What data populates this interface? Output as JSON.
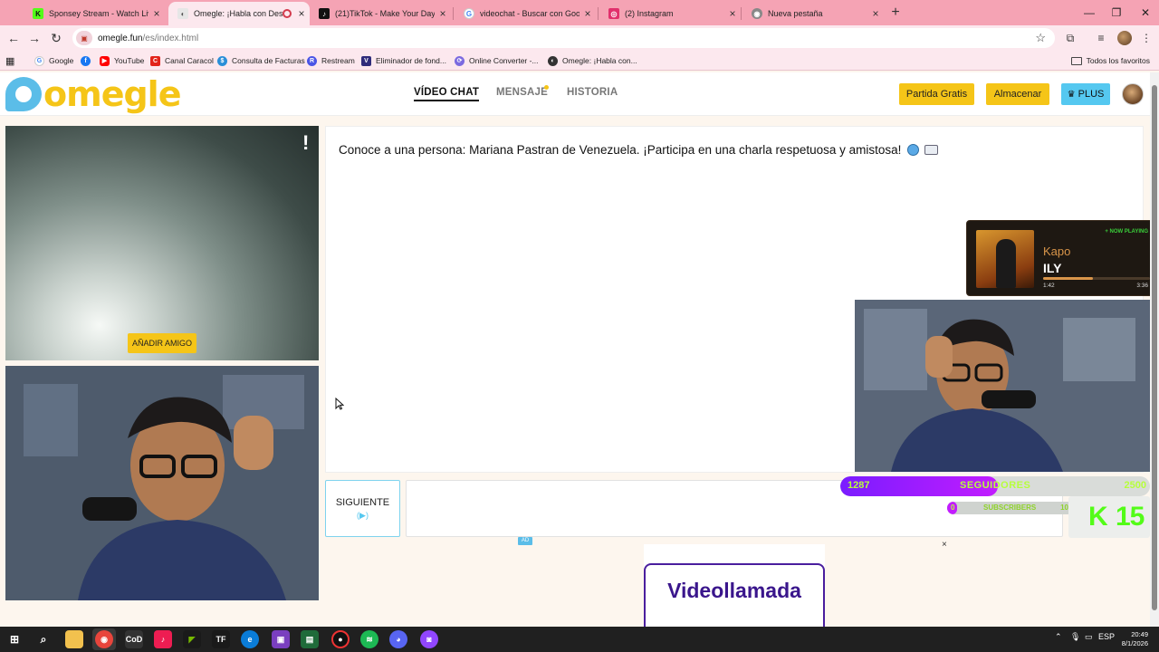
{
  "browser": {
    "tabs": [
      {
        "label": "Sponsey Stream - Watch Live o",
        "icon": "kick-icon",
        "color": "#53fc18",
        "active": false
      },
      {
        "label": "Omegle: ¡Habla con Descon",
        "icon": "omegle-icon",
        "color": "#888888",
        "active": true
      },
      {
        "label": "(21)TikTok - Make Your Day",
        "icon": "tiktok-icon",
        "color": "#111111",
        "active": false
      },
      {
        "label": "videochat - Buscar con Google",
        "icon": "google-icon",
        "color": "#4285f4",
        "active": false
      },
      {
        "label": "(2) Instagram",
        "icon": "instagram-icon",
        "color": "#e1306c",
        "active": false
      },
      {
        "label": "Nueva pestaña",
        "icon": "chrome-icon",
        "color": "#666666",
        "active": false
      }
    ],
    "url_host": "omegle.fun",
    "url_path": "/es/index.html",
    "bookmarks": [
      {
        "label": "Google",
        "icon": "google-icon",
        "color": "#4285f4"
      },
      {
        "label": "YouTube",
        "icon": "youtube-icon",
        "color": "#ff0000"
      },
      {
        "label": "Canal Caracol",
        "icon": "caracol-icon",
        "color": "#e2231a"
      },
      {
        "label": "Consulta de Facturas",
        "icon": "invoice-icon",
        "color": "#2a8fd8"
      },
      {
        "label": "Restream",
        "icon": "restream-icon",
        "color": "#4a55e6"
      },
      {
        "label": "Eliminador de fond...",
        "icon": "remove-bg-icon",
        "color": "#2f2b7a"
      },
      {
        "label": "Online Converter -...",
        "icon": "converter-icon",
        "color": "#7b6ae0"
      },
      {
        "label": "Omegle: ¡Habla con...",
        "icon": "omegle-icon",
        "color": "#333333"
      }
    ],
    "all_bookmarks": "Todos los favoritos"
  },
  "site": {
    "logo": "omegle",
    "nav": [
      {
        "label": "VÍDEO CHAT",
        "active": true
      },
      {
        "label": "MENSAJE",
        "active": false,
        "badge": true
      },
      {
        "label": "HISTORIA",
        "active": false
      }
    ],
    "buttons": {
      "free_match": "Partida Gratis",
      "store": "Almacenar",
      "plus": "PLUS"
    },
    "report_mark": "!",
    "add_friend": "AÑADIR AMIGO",
    "welcome": "Conoce a una persona: Mariana Pastran de Venezuela. ¡Participa en una charla respetuosa y amistosa!",
    "next_label": "SIGUIENTE",
    "next_sub": "(▶)",
    "ad_badge": "AD",
    "ad_title": "Videollamada",
    "ad_close": "×",
    "accent": "#f5c518",
    "accent_blue": "#55c8f0"
  },
  "overlays": {
    "now_playing": {
      "tag": "+ NOW PLAYING",
      "artist": "Kapo",
      "song": "ILY",
      "elapsed": "1:42",
      "total": "3:36",
      "progress": 0.47
    },
    "followers": {
      "current": "1287",
      "label": "SEGUIDORES",
      "goal": "2500",
      "progress": 0.51
    },
    "subs": {
      "current": "0",
      "label": "SUBSCRIBERS",
      "goal": "10",
      "progress": 0.08
    },
    "kick": {
      "number": "15",
      "color": "#53fc18"
    }
  },
  "taskbar": {
    "lang": "ESP",
    "time": "20:49",
    "date": "8/1/2026"
  }
}
